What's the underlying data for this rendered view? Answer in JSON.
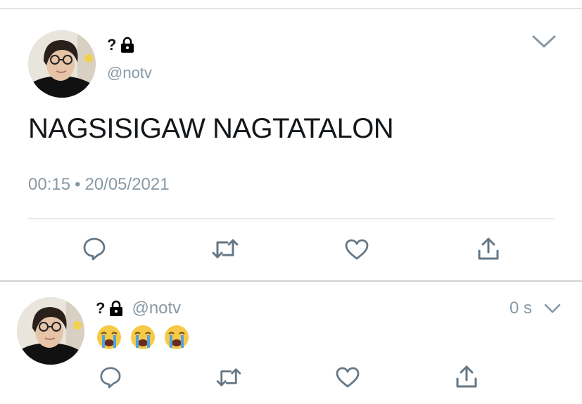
{
  "main_tweet": {
    "name": "?",
    "handle": "@notv",
    "text": "NAGSISIGAW NAGTATALON",
    "time": "00:15",
    "separator": "•",
    "date": "20/05/2021",
    "icons": {
      "lock": "lock-icon",
      "menu": "chevron-down-icon",
      "reply": "reply-icon",
      "retweet": "retweet-icon",
      "like": "heart-icon",
      "share": "share-icon"
    }
  },
  "reply_tweet": {
    "name": "?",
    "handle": "@notv",
    "time": "0 s",
    "emoji": [
      "😭",
      "😭",
      "😭"
    ],
    "icons": {
      "lock": "lock-icon",
      "menu": "chevron-down-icon",
      "reply": "reply-icon",
      "retweet": "retweet-icon",
      "like": "heart-icon",
      "share": "share-icon"
    }
  },
  "colors": {
    "text": "#14171a",
    "secondary": "#8899a6",
    "divider": "#cfd3d6",
    "icon": "#657786"
  }
}
